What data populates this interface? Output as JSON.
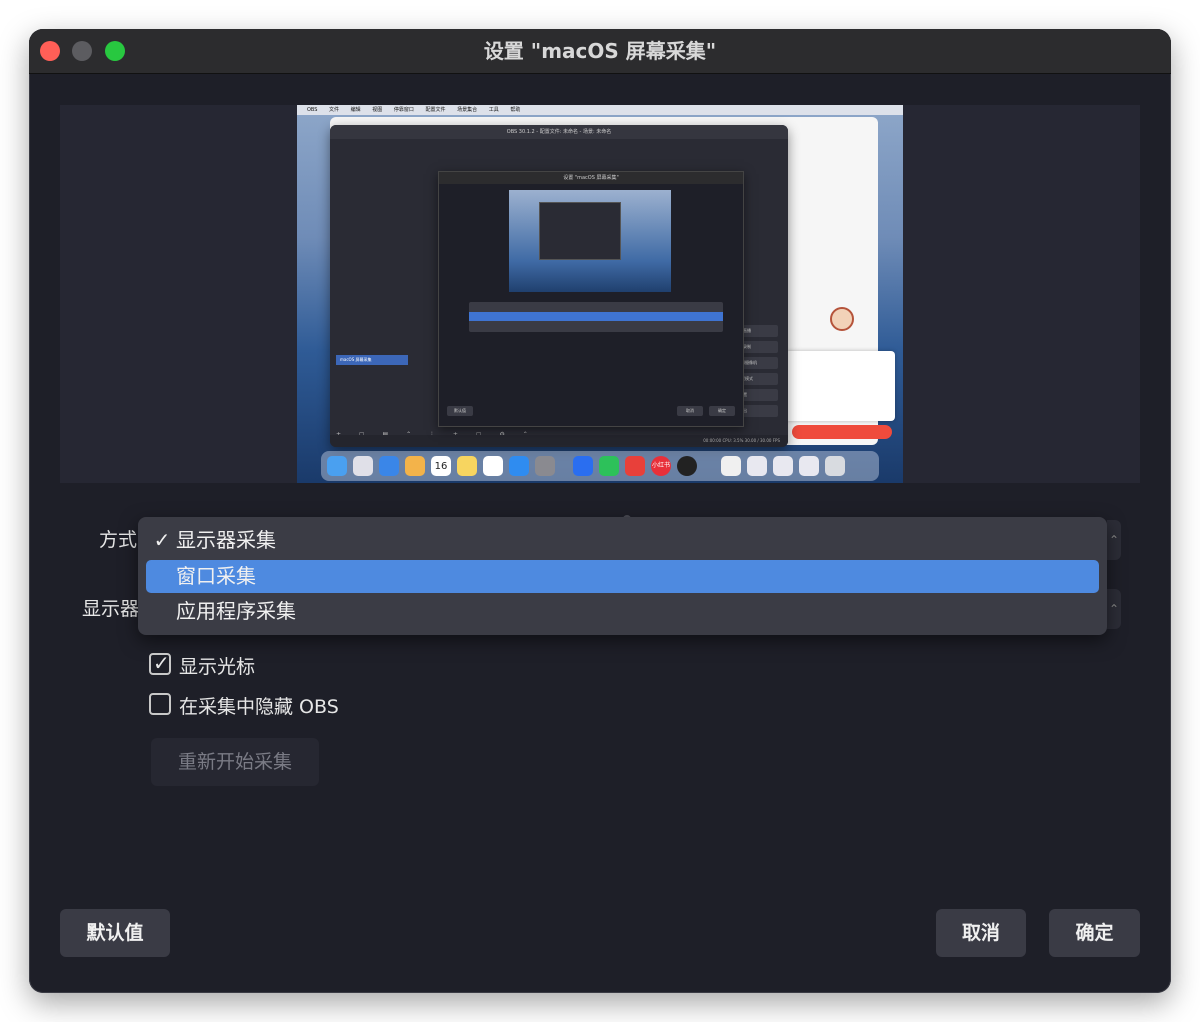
{
  "window": {
    "title": "设置 \"macOS 屏幕采集\""
  },
  "preview": {
    "menubar_items": [
      "OBS",
      "文件",
      "编辑",
      "视图",
      "停靠窗口",
      "配置文件",
      "场景集合",
      "工具",
      "帮助"
    ],
    "obs_window_title": "OBS 30.1.2 - 配置文件: 未命名 - 场景: 未命名",
    "nested_dialog_title": "设置 \"macOS 屏幕采集\"",
    "nested_options": [
      "显示器采集",
      "窗口采集",
      "应用程序采集"
    ],
    "sources_label": "macOS 屏幕采集",
    "controls": [
      "开始直播",
      "开始录制",
      "启动虚拟摄像机",
      "工作室模式",
      "设置",
      "退出"
    ],
    "status_text": "00:00:00  CPU: 3.5%  30.00 / 30.00 FPS",
    "dock_date": "16",
    "dock_badge": "小红书"
  },
  "form": {
    "method_label": "方式",
    "display_label": "显示器",
    "dropdown": {
      "options": [
        {
          "label": "显示器采集",
          "checked": true,
          "highlighted": false
        },
        {
          "label": "窗口采集",
          "checked": false,
          "highlighted": true
        },
        {
          "label": "应用程序采集",
          "checked": false,
          "highlighted": false
        }
      ],
      "check_glyph": "✓"
    },
    "show_cursor": {
      "label": "显示光标",
      "checked": true
    },
    "hide_obs": {
      "label": "在采集中隐藏 OBS",
      "checked": false
    },
    "restart_button": "重新开始采集"
  },
  "footer": {
    "defaults_button": "默认值",
    "cancel_button": "取消",
    "ok_button": "确定"
  },
  "colors": {
    "highlight": "#4e8ae0",
    "window_bg": "#1e1f28"
  }
}
